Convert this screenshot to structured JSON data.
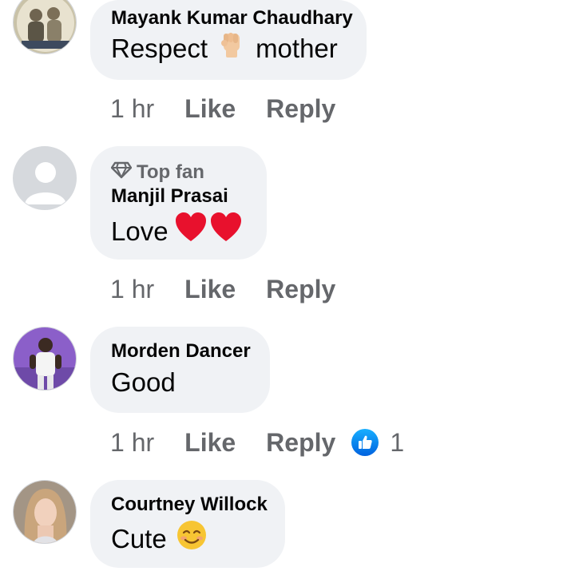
{
  "comments": [
    {
      "author": "Mayank Kumar Chaudhary",
      "text_before": "Respect",
      "emoji": "raised-fist-icon",
      "text_after": "mother",
      "time": "1 hr",
      "like_label": "Like",
      "reply_label": "Reply"
    },
    {
      "badge": "Top fan",
      "author": "Manjil Prasai",
      "text": "Love",
      "emoji": "red-heart-icon",
      "time": "1 hr",
      "like_label": "Like",
      "reply_label": "Reply"
    },
    {
      "author": "Morden Dancer",
      "text": "Good",
      "time": "1 hr",
      "like_label": "Like",
      "reply_label": "Reply",
      "reaction_count": "1",
      "reaction_icon": "like-reaction-icon"
    },
    {
      "author": "Courtney Willock",
      "text": "Cute",
      "emoji": "smiling-face-icon"
    }
  ],
  "colors": {
    "bubble_bg": "#f0f2f5",
    "meta_text": "#65676b",
    "like_blue": "#0866ff",
    "heart_red": "#e8112d"
  }
}
